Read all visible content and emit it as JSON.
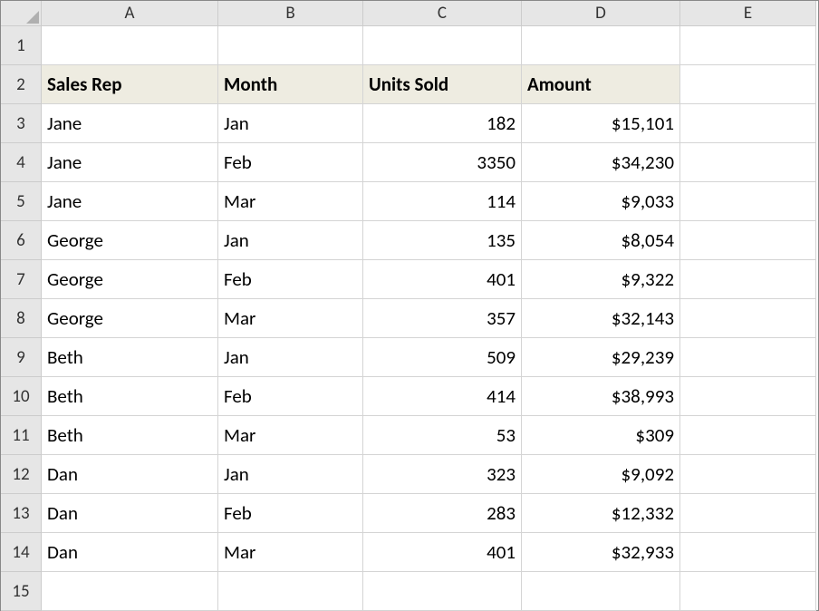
{
  "columns": [
    "A",
    "B",
    "C",
    "D",
    "E"
  ],
  "rowNumbers": [
    1,
    2,
    3,
    4,
    5,
    6,
    7,
    8,
    9,
    10,
    11,
    12,
    13,
    14,
    15
  ],
  "headers": {
    "salesRep": "Sales Rep",
    "month": "Month",
    "unitsSold": "Units Sold",
    "amount": "Amount"
  },
  "rows": [
    {
      "salesRep": "Jane",
      "month": "Jan",
      "unitsSold": "182",
      "amount": "$15,101"
    },
    {
      "salesRep": "Jane",
      "month": "Feb",
      "unitsSold": "3350",
      "amount": "$34,230"
    },
    {
      "salesRep": "Jane",
      "month": "Mar",
      "unitsSold": "114",
      "amount": "$9,033"
    },
    {
      "salesRep": "George",
      "month": "Jan",
      "unitsSold": "135",
      "amount": "$8,054"
    },
    {
      "salesRep": "George",
      "month": "Feb",
      "unitsSold": "401",
      "amount": "$9,322"
    },
    {
      "salesRep": "George",
      "month": "Mar",
      "unitsSold": "357",
      "amount": "$32,143"
    },
    {
      "salesRep": "Beth",
      "month": "Jan",
      "unitsSold": "509",
      "amount": "$29,239"
    },
    {
      "salesRep": "Beth",
      "month": "Feb",
      "unitsSold": "414",
      "amount": "$38,993"
    },
    {
      "salesRep": "Beth",
      "month": "Mar",
      "unitsSold": "53",
      "amount": "$309"
    },
    {
      "salesRep": "Dan",
      "month": "Jan",
      "unitsSold": "323",
      "amount": "$9,092"
    },
    {
      "salesRep": "Dan",
      "month": "Feb",
      "unitsSold": "283",
      "amount": "$12,332"
    },
    {
      "salesRep": "Dan",
      "month": "Mar",
      "unitsSold": "401",
      "amount": "$32,933"
    }
  ]
}
